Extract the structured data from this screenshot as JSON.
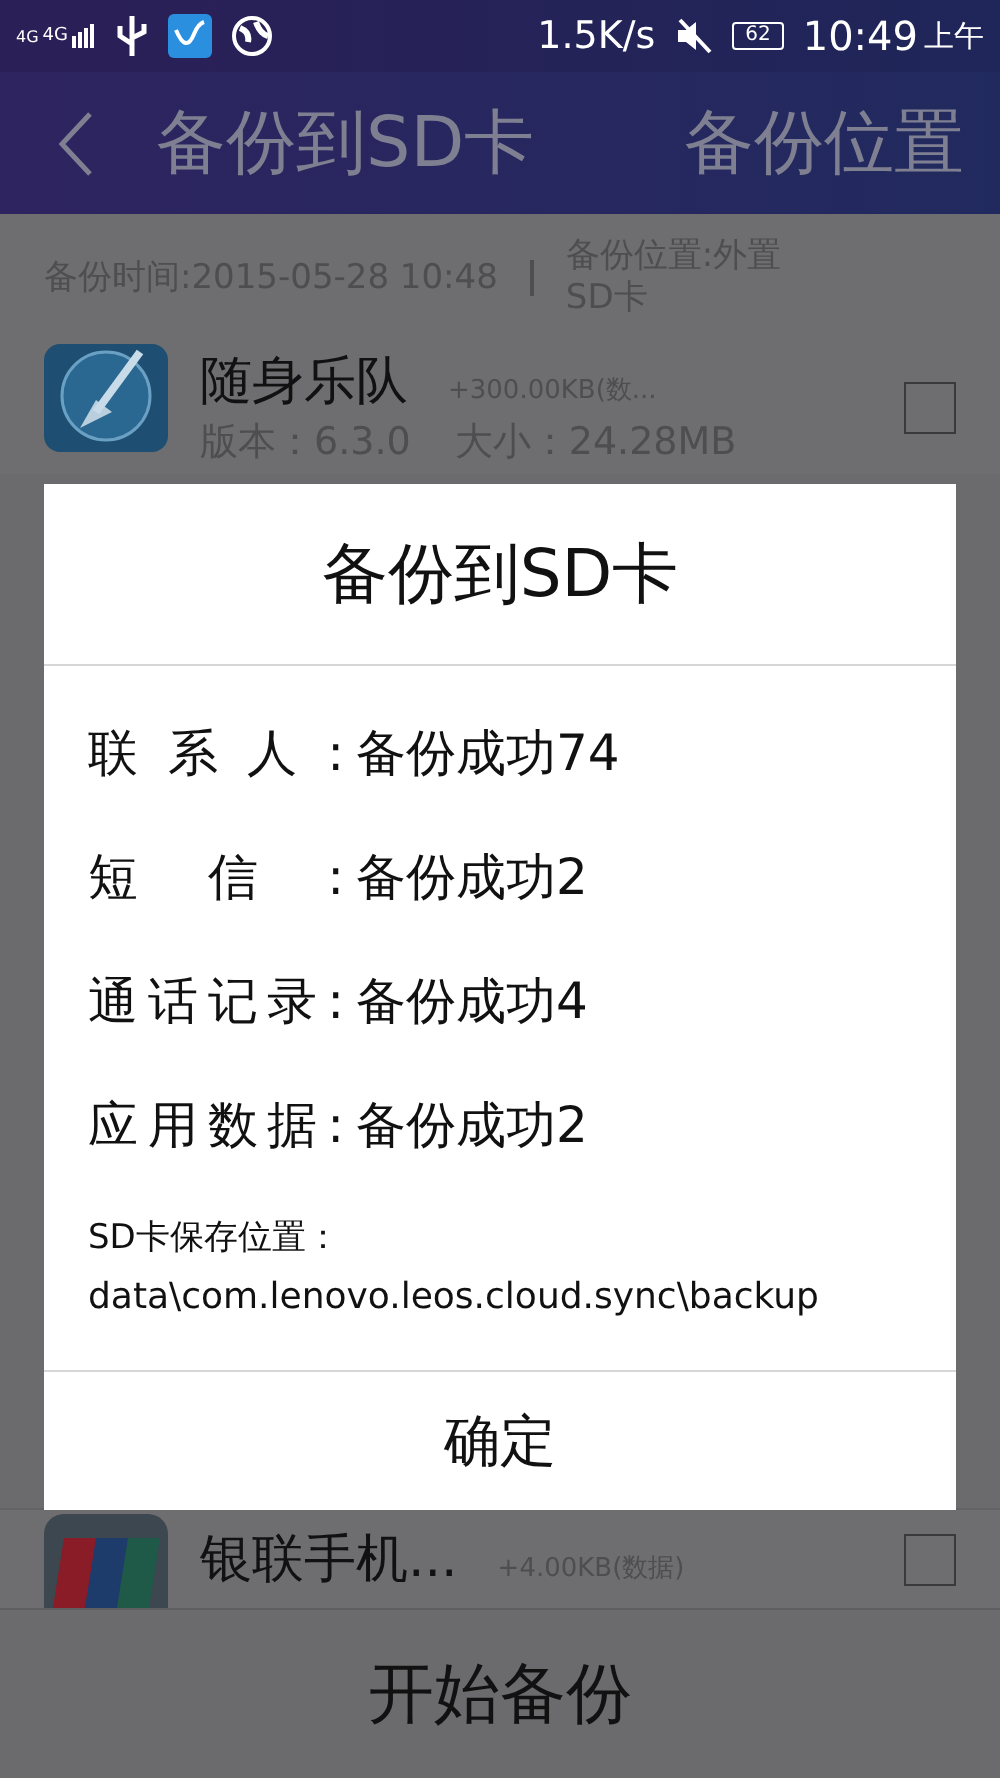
{
  "status_bar": {
    "signal_labels": [
      "4G",
      "4G"
    ],
    "network_speed": "1.5K/s",
    "battery": "62",
    "time": "10:49",
    "time_period": "上午"
  },
  "app_bar": {
    "title": "备份到SD卡",
    "action": "备份位置"
  },
  "backup_info": {
    "time": "备份时间:2015-05-28 10:48",
    "location": "备份位置:外置SD卡"
  },
  "apps": [
    {
      "name": "随身乐队",
      "extra": "+300.00KB(数...",
      "version": "版本：6.3.0",
      "size": "大小：24.28MB",
      "checked": false
    },
    {
      "name": "银联手机...",
      "extra": "+4.00KB(数据)",
      "checked": false
    }
  ],
  "dialog": {
    "title": "备份到SD卡",
    "results": [
      {
        "label": "联系人:",
        "value": "备份成功74"
      },
      {
        "label": "短信:",
        "value": "备份成功2"
      },
      {
        "label": "通话记录:",
        "value": "备份成功4"
      },
      {
        "label": "应用数据:",
        "value": "备份成功2"
      }
    ],
    "path_label": "SD卡保存位置：",
    "path": "data\\com.lenovo.leos.cloud.sync\\backup",
    "ok_button": "确定"
  },
  "start_button": "开始备份"
}
